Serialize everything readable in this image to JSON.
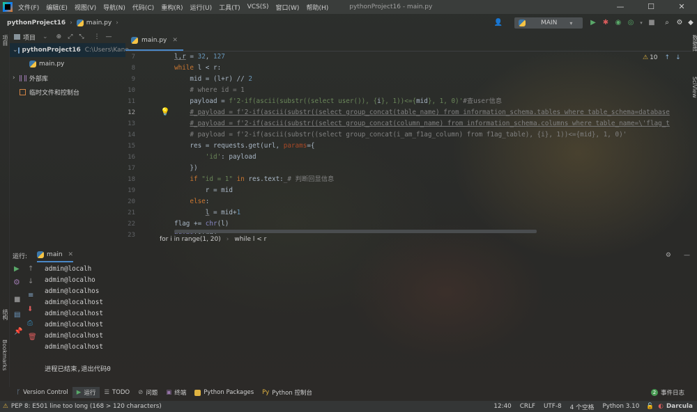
{
  "menubar": {
    "items": [
      "文件(F)",
      "编辑(E)",
      "视图(V)",
      "导航(N)",
      "代码(C)",
      "重构(R)",
      "运行(U)",
      "工具(T)",
      "VCS(S)",
      "窗口(W)",
      "帮助(H)"
    ],
    "window_title": "pythonProject16 - main.py",
    "minimize": "—",
    "maximize": "☐",
    "close": "✕"
  },
  "navbar": {
    "project": "pythonProject16",
    "file": "main.py",
    "run_config": "MAIN"
  },
  "left_stripe": {
    "project_label": "项目",
    "structure_label": "结构",
    "bookmarks_label": "Bookmarks"
  },
  "right_stripe": {
    "db_label": "数据库",
    "sciview_label": "SciView"
  },
  "project_panel": {
    "title": "项目",
    "root_name": "pythonProject16",
    "root_path": "C:\\Users\\Kane",
    "file": "main.py",
    "external": "外部库",
    "scratches": "临时文件和控制台"
  },
  "editor": {
    "tab_label": "main.py",
    "warnings_count": "10",
    "line_numbers": [
      "7",
      "8",
      "9",
      "10",
      "11",
      "12",
      "13",
      "14",
      "15",
      "16",
      "17",
      "18",
      "19",
      "20",
      "21",
      "22",
      "23"
    ],
    "breadcrumb": [
      "for i in range(1, 20)",
      "while l < r"
    ]
  },
  "run_panel": {
    "label": "运行:",
    "tab": "main",
    "output": [
      "admin@localh",
      "admin@localho",
      "admin@localhos",
      "admin@localhost",
      "admin@localhost",
      "admin@localhost",
      "admin@localhost",
      "admin@localhost"
    ],
    "exit_message": "进程已结束,退出代码0"
  },
  "tool_windows": {
    "version_control": "Version Control",
    "run": "运行",
    "todo": "TODO",
    "problems": "问题",
    "terminal": "终端",
    "python_packages": "Python Packages",
    "python_console": "Python 控制台",
    "event_log": "事件日志",
    "event_count": "2"
  },
  "status_bar": {
    "message": "PEP 8: E501 line too long (168 > 120 characters)",
    "position": "12:40",
    "line_sep": "CRLF",
    "encoding": "UTF-8",
    "indent": "4 个空格",
    "interpreter": "Python 3.10",
    "theme": "Darcula"
  },
  "colors": {
    "accent": "#4a88c7",
    "keyword": "#cc7832",
    "string": "#6a8759",
    "number": "#6897bb",
    "comment": "#808080"
  }
}
